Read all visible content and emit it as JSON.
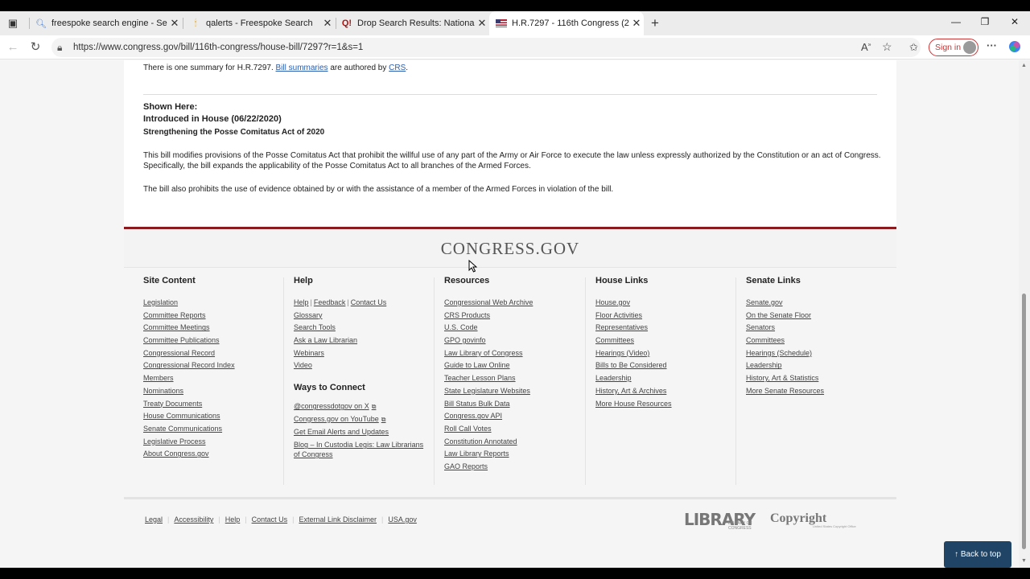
{
  "browser": {
    "tabs": [
      {
        "title": "freespoke search engine - Search",
        "favicon": "search-icon",
        "active": false
      },
      {
        "title": "qalerts - Freespoke Search",
        "favicon": "freespoke-icon",
        "active": false
      },
      {
        "title": "Drop Search Results: National Gu",
        "favicon": "q-icon",
        "active": false
      },
      {
        "title": "H.R.7297 - 116th Congress (2019-",
        "favicon": "us-flag-icon",
        "active": true
      }
    ],
    "url": "https://www.congress.gov/bill/116th-congress/house-bill/7297?r=1&s=1",
    "signin_label": "Sign in"
  },
  "summary": {
    "count_text": "There is one summary for H.R.7297.",
    "link1": "Bill summaries",
    "mid_text": "are authored by",
    "link2": "CRS",
    "end": ".",
    "shown_here": "Shown Here:",
    "version": "Introduced in House (06/22/2020)",
    "bill_title": "Strengthening the Posse Comitatus Act of 2020",
    "para1_line1": "This bill modifies provisions of the Posse Comitatus Act that prohibit the willful use of any part of the Army or Air Force to execute the law unless expressly authorized by the Constitution or an act of Congress.",
    "para1_line2": "Specifically, the bill expands the applicability of the Posse Comitatus Act to all branches of the Armed Forces.",
    "para2": "The bill also prohibits the use of evidence obtained by or with the assistance of a member of the Armed Forces in violation of the bill."
  },
  "footer": {
    "logo": "CONGRESS.GOV",
    "site_content": {
      "heading": "Site Content",
      "links": [
        "Legislation",
        "Committee Reports",
        "Committee Meetings",
        "Committee Publications",
        "Congressional Record",
        "Congressional Record Index",
        "Members",
        "Nominations",
        "Treaty Documents",
        "House Communications",
        "Senate Communications",
        "Legislative Process",
        "About Congress.gov"
      ]
    },
    "help": {
      "heading": "Help",
      "top_links": [
        "Help",
        "Feedback",
        "Contact Us"
      ],
      "links": [
        "Glossary",
        "Search Tools",
        "Ask a Law Librarian",
        "Webinars",
        "Video"
      ],
      "ways_heading": "Ways to Connect",
      "ways_links": [
        "@congressdotgov on X",
        "Congress.gov on YouTube",
        "Get Email Alerts and Updates",
        "Blog – In Custodia Legis: Law Librarians",
        "of Congress"
      ]
    },
    "resources": {
      "heading": "Resources",
      "links": [
        "Congressional Web Archive",
        "CRS Products",
        "U.S. Code",
        "GPO govinfo",
        "Law Library of Congress",
        "Guide to Law Online",
        "Teacher Lesson Plans",
        "State Legislature Websites",
        "Bill Status Bulk Data",
        "Congress.gov API",
        "Roll Call Votes",
        "Constitution Annotated",
        "Law Library Reports",
        "GAO Reports"
      ]
    },
    "house": {
      "heading": "House Links",
      "links": [
        "House.gov",
        "Floor Activities",
        "Representatives",
        "Committees",
        "Hearings (Video)",
        "Bills to Be Considered",
        "Leadership",
        "History, Art & Archives",
        "More House Resources"
      ]
    },
    "senate": {
      "heading": "Senate Links",
      "links": [
        "Senate.gov",
        "On the Senate Floor",
        "Senators",
        "Committees",
        "Hearings (Schedule)",
        "Leadership",
        "History, Art & Statistics",
        "More Senate Resources"
      ]
    },
    "legal_links": [
      "Legal",
      "Accessibility",
      "Help",
      "Contact Us",
      "External Link Disclaimer",
      "USA.gov"
    ],
    "loc_logo": "LIBRARY",
    "loc_sub": "LIBRARY OF CONGRESS",
    "copyright_logo": "Copyright",
    "copyright_sub": "United States Copyright Office",
    "back_to_top": "Back to top"
  }
}
